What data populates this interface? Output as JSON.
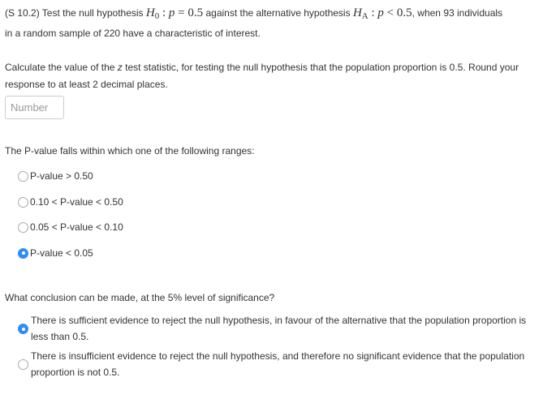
{
  "question": {
    "prefix": "(S 10.2) Test the null hypothesis",
    "h0_symbol": "H",
    "h0_sub": "0",
    "h0_expr_var": "p",
    "h0_expr_rest": " = 0.5",
    "middle": "against the alternative hypothesis",
    "ha_symbol": "H",
    "ha_sub": "A",
    "ha_expr_var": "p",
    "ha_expr_rest": " < 0.5",
    "suffix_line1": ", when 93 individuals",
    "line2": "in a random sample of 220 have a characteristic of interest."
  },
  "part1": {
    "text_before_z": "Calculate the value of the",
    "z_var": "z",
    "text_after_z": "test statistic, for testing the null hypothesis that the population proportion is 0.5.  Round your response to at least 2 decimal places.",
    "input_value": "",
    "input_placeholder": "Number"
  },
  "part2": {
    "prompt": "The P-value falls within which one of the following ranges:",
    "options": [
      {
        "label": "P-value > 0.50",
        "checked": false
      },
      {
        "label": "0.10 < P-value < 0.50",
        "checked": false
      },
      {
        "label": "0.05 < P-value < 0.10",
        "checked": false
      },
      {
        "label": "P-value < 0.05",
        "checked": true
      }
    ]
  },
  "part3": {
    "prompt": "What conclusion can be made, at the 5% level of significance?",
    "options": [
      {
        "label": "There is sufficient evidence to reject the null hypothesis, in favour of the alternative that the population proportion is less than 0.5.",
        "checked": true
      },
      {
        "label": "There is insufficient evidence to reject the null hypothesis, and therefore no significant evidence that the population proportion is not 0.5.",
        "checked": false
      }
    ]
  },
  "colors": {
    "accent": "#2e8ef8",
    "text": "#333333",
    "placeholder": "#999999"
  }
}
